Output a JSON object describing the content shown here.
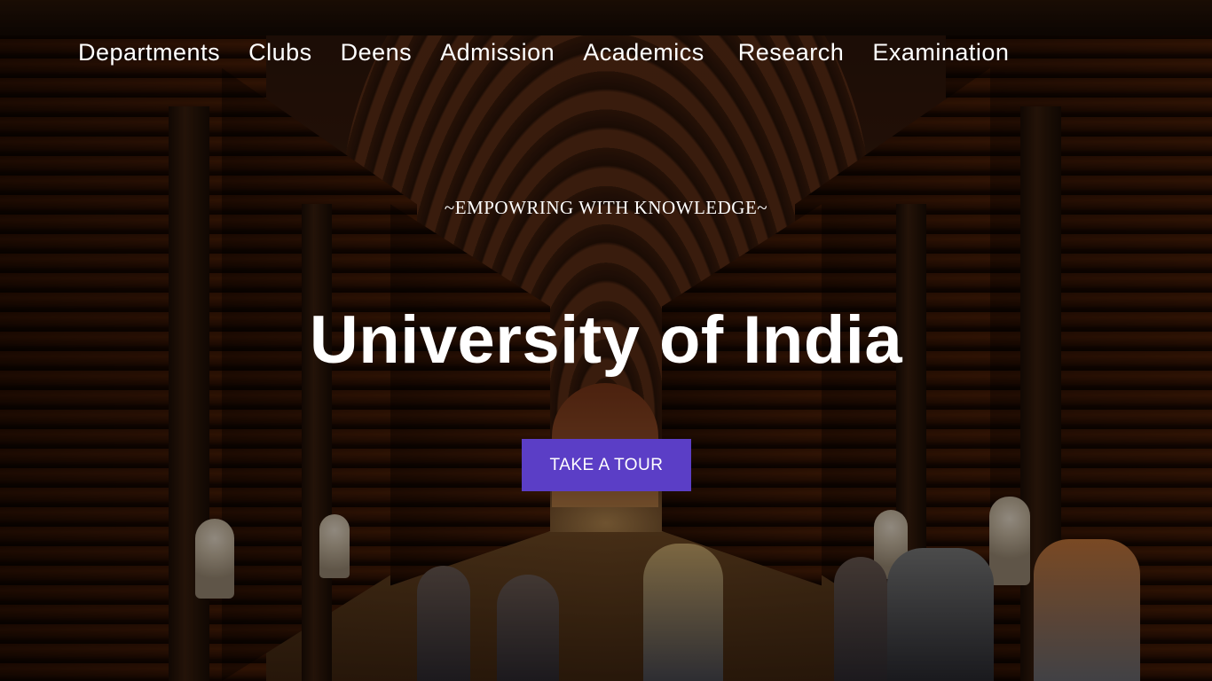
{
  "nav": {
    "items": [
      {
        "label": "Departments"
      },
      {
        "label": "Clubs"
      },
      {
        "label": "Deens"
      },
      {
        "label": "Admission"
      },
      {
        "label": "Academics"
      },
      {
        "label": "Research"
      },
      {
        "label": "Examination"
      }
    ]
  },
  "hero": {
    "tagline": "~EMPOWRING WITH KNOWLEDGE~",
    "title": "University of India",
    "cta_label": "TAKE A TOUR"
  },
  "colors": {
    "cta_background": "#5b3ec6",
    "text": "#ffffff"
  }
}
